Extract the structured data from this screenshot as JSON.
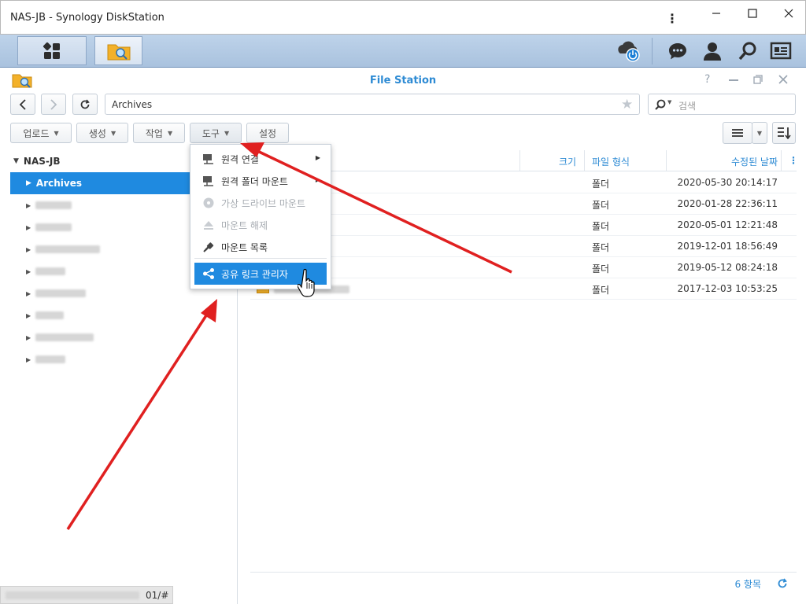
{
  "window": {
    "title": "NAS-JB - Synology DiskStation"
  },
  "app": {
    "title": "File Station"
  },
  "path": {
    "value": "Archives"
  },
  "search": {
    "placeholder": "검색"
  },
  "toolbar": {
    "upload": "업로드",
    "create": "생성",
    "action": "작업",
    "tools": "도구",
    "settings": "설정"
  },
  "tree": {
    "root": "NAS-JB",
    "selected": "Archives"
  },
  "columns": {
    "size": "크기",
    "type": "파일 형식",
    "modified": "수정된 날짜"
  },
  "rows": [
    {
      "type": "폴더",
      "date": "2020-05-30 20:14:17"
    },
    {
      "type": "폴더",
      "date": "2020-01-28 22:36:11"
    },
    {
      "type": "폴더",
      "date": "2020-05-01 12:21:48"
    },
    {
      "type": "폴더",
      "date": "2019-12-01 18:56:49"
    },
    {
      "type": "폴더",
      "date": "2019-05-12 08:24:18"
    },
    {
      "type": "폴더",
      "date": "2017-12-03 10:53:25"
    }
  ],
  "menu": {
    "items": [
      {
        "label": "원격 연결",
        "state": "enabled",
        "submenu": true,
        "icon": "network-icon"
      },
      {
        "label": "원격 폴더 마운트",
        "state": "enabled",
        "submenu": true,
        "icon": "network-folder-icon"
      },
      {
        "label": "가상 드라이브 마운트",
        "state": "disabled",
        "submenu": false,
        "icon": "disc-icon"
      },
      {
        "label": "마운트 해제",
        "state": "disabled",
        "submenu": false,
        "icon": "eject-icon"
      },
      {
        "label": "마운트 목록",
        "state": "enabled",
        "submenu": false,
        "icon": "plug-icon"
      },
      {
        "label": "공유 링크 관리자",
        "state": "selected",
        "submenu": false,
        "icon": "share-icon"
      }
    ]
  },
  "footer": {
    "count": "6 항목"
  },
  "status": {
    "url_tail": "01/#"
  },
  "colors": {
    "accent": "#2e8bd4",
    "selection": "#1f8ae0",
    "arrow": "#e02020"
  }
}
